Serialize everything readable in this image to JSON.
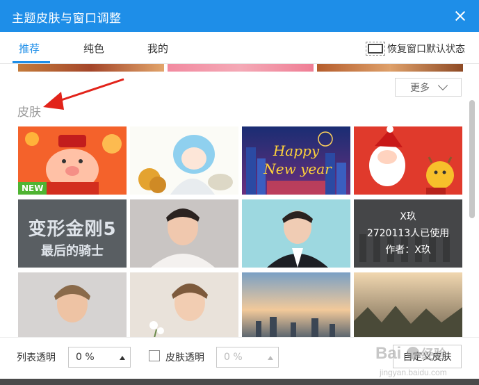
{
  "window": {
    "title": "主题皮肤与窗口调整"
  },
  "tabs": [
    {
      "label": "推荐"
    },
    {
      "label": "纯色"
    },
    {
      "label": "我的"
    }
  ],
  "restore_label": "恢复窗口默认状态",
  "more_label": "更多",
  "section_title": "皮肤",
  "tiles": [
    {
      "name": "pig-god-of-wealth",
      "badge": "NEW"
    },
    {
      "name": "cat-girl-cartoon"
    },
    {
      "name": "happy-new-year"
    },
    {
      "name": "santa-and-reindeer"
    },
    {
      "name": "transformers-5",
      "title_line1": "变形金刚5",
      "title_line2": "最后的骑士"
    },
    {
      "name": "celebrity-white-shirt"
    },
    {
      "name": "celebrity-suit"
    },
    {
      "name": "x-jiu-dancers",
      "overlay_name": "X玖",
      "overlay_users": "2720113人已使用",
      "overlay_author": "作者：X玖"
    },
    {
      "name": "young-man-portrait"
    },
    {
      "name": "young-man-flowers"
    },
    {
      "name": "city-sunset"
    },
    {
      "name": "forest-sunrise"
    }
  ],
  "bottom": {
    "list_transparency_label": "列表透明",
    "list_transparency_value": "0 %",
    "skin_transparency_label": "皮肤透明",
    "skin_transparency_value": "0 %",
    "custom_skin_label": "自定义皮肤"
  },
  "watermark": {
    "brand": "Baidu经验",
    "url": "jingyan.baidu.com"
  },
  "colors": {
    "accent": "#1e8ee8",
    "new_badge": "#4fb432"
  }
}
